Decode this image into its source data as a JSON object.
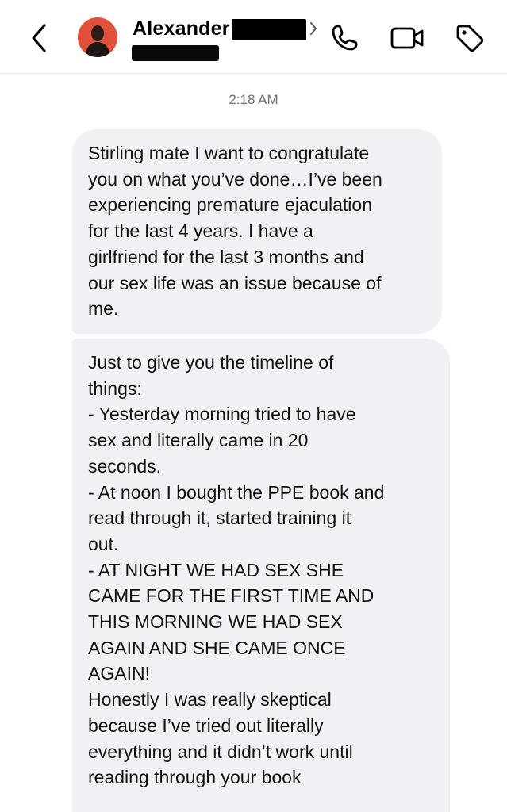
{
  "header": {
    "contact_name": "Alexander",
    "back_icon": "chevron-left-icon",
    "details_icon": "chevron-right-icon",
    "actions": [
      {
        "name": "phone-button",
        "icon": "phone-icon"
      },
      {
        "name": "video-call-button",
        "icon": "video-camera-icon"
      },
      {
        "name": "tag-button",
        "icon": "tag-icon"
      }
    ],
    "avatar_color": "#e3503a"
  },
  "conversation": {
    "timestamp": "2:18 AM",
    "messages": [
      {
        "direction": "incoming",
        "text": "Stirling mate I want to congratulate\nyou on what you’ve done…I’ve been\nexperiencing premature ejaculation\nfor the last 4 years. I have a\ngirlfriend for the last 3 months and\nour sex life was an issue because of\nme."
      },
      {
        "direction": "incoming",
        "text": "Just to give you the timeline of\nthings:\n- Yesterday morning tried to have\nsex and literally came in 20\nseconds.\n- At noon I bought the PPE book and\nread through it, started training it\nout.\n- AT NIGHT WE HAD SEX SHE\nCAME FOR THE FIRST TIME AND\nTHIS MORNING WE HAD SEX\nAGAIN AND SHE CAME ONCE\nAGAIN!\nHonestly I was really skeptical\nbecause I’ve tried out literally\neverything and it didn’t work until\nreading through your book"
      }
    ],
    "bubble_color": "#f0f1f5"
  }
}
